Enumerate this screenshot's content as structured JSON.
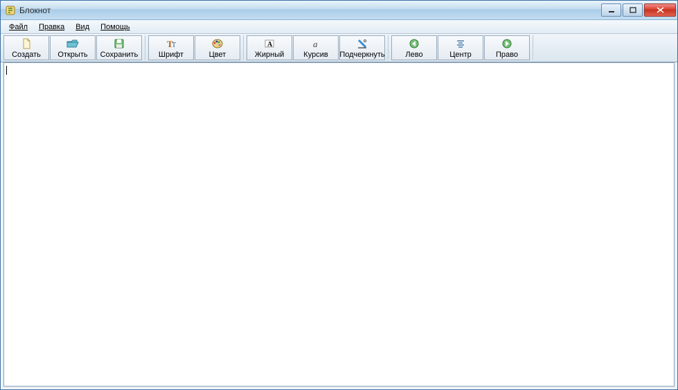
{
  "window": {
    "title": "Блокнот"
  },
  "menubar": {
    "items": [
      "Файл",
      "Правка",
      "Вид",
      "Помощь"
    ]
  },
  "toolbar": {
    "groups": [
      {
        "buttons": [
          {
            "label": "Создать",
            "icon": "new-file-icon"
          },
          {
            "label": "Открыть",
            "icon": "open-folder-icon"
          },
          {
            "label": "Сохранить",
            "icon": "save-disk-icon"
          }
        ]
      },
      {
        "buttons": [
          {
            "label": "Шрифт",
            "icon": "font-icon"
          },
          {
            "label": "Цвет",
            "icon": "color-palette-icon"
          }
        ]
      },
      {
        "buttons": [
          {
            "label": "Жирный",
            "icon": "bold-icon"
          },
          {
            "label": "Курсив",
            "icon": "italic-icon"
          },
          {
            "label": "Подчеркнуть",
            "icon": "underline-icon"
          }
        ]
      },
      {
        "buttons": [
          {
            "label": "Лево",
            "icon": "align-left-icon"
          },
          {
            "label": "Центр",
            "icon": "align-center-icon"
          },
          {
            "label": "Право",
            "icon": "align-right-icon"
          }
        ]
      }
    ]
  },
  "editor": {
    "content": ""
  }
}
